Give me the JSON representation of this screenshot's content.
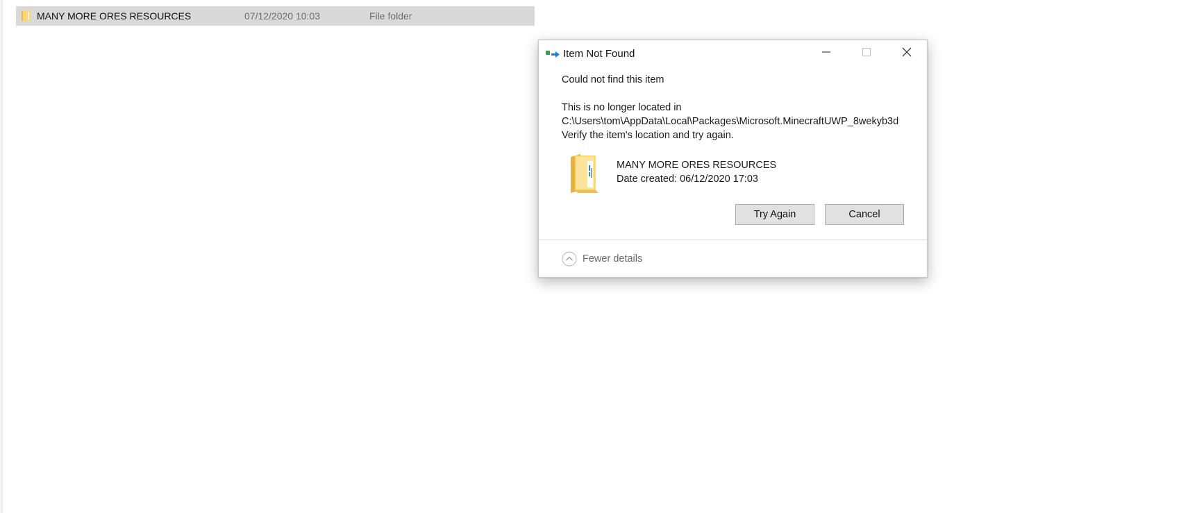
{
  "explorer": {
    "row": {
      "name": "MANY MORE ORES RESOURCES",
      "date_modified": "07/12/2020 10:03",
      "type": "File folder"
    }
  },
  "dialog": {
    "title": "Item Not Found",
    "heading": "Could not find this item",
    "description_line1": "This is no longer located in",
    "description_line2": "C:\\Users\\tom\\AppData\\Local\\Packages\\Microsoft.MinecraftUWP_8wekyb3d",
    "description_line3": "Verify the item's location and try again.",
    "item": {
      "name": "MANY MORE ORES RESOURCES",
      "date_label": "Date created:",
      "date_value": "06/12/2020 17:03"
    },
    "buttons": {
      "try_again": "Try Again",
      "cancel": "Cancel"
    },
    "details_toggle": "Fewer details",
    "icons": {
      "title_icon": "move-file-icon",
      "item_icon": "folder-icon",
      "minimize": "minimize-icon",
      "maximize": "maximize-icon",
      "close": "close-icon",
      "toggle": "chevron-up-icon"
    },
    "colors": {
      "button_face": "#e1e1e1",
      "button_border": "#adadad",
      "selected_row": "#d9d9d9",
      "folder_yellow": "#f8d775"
    }
  }
}
